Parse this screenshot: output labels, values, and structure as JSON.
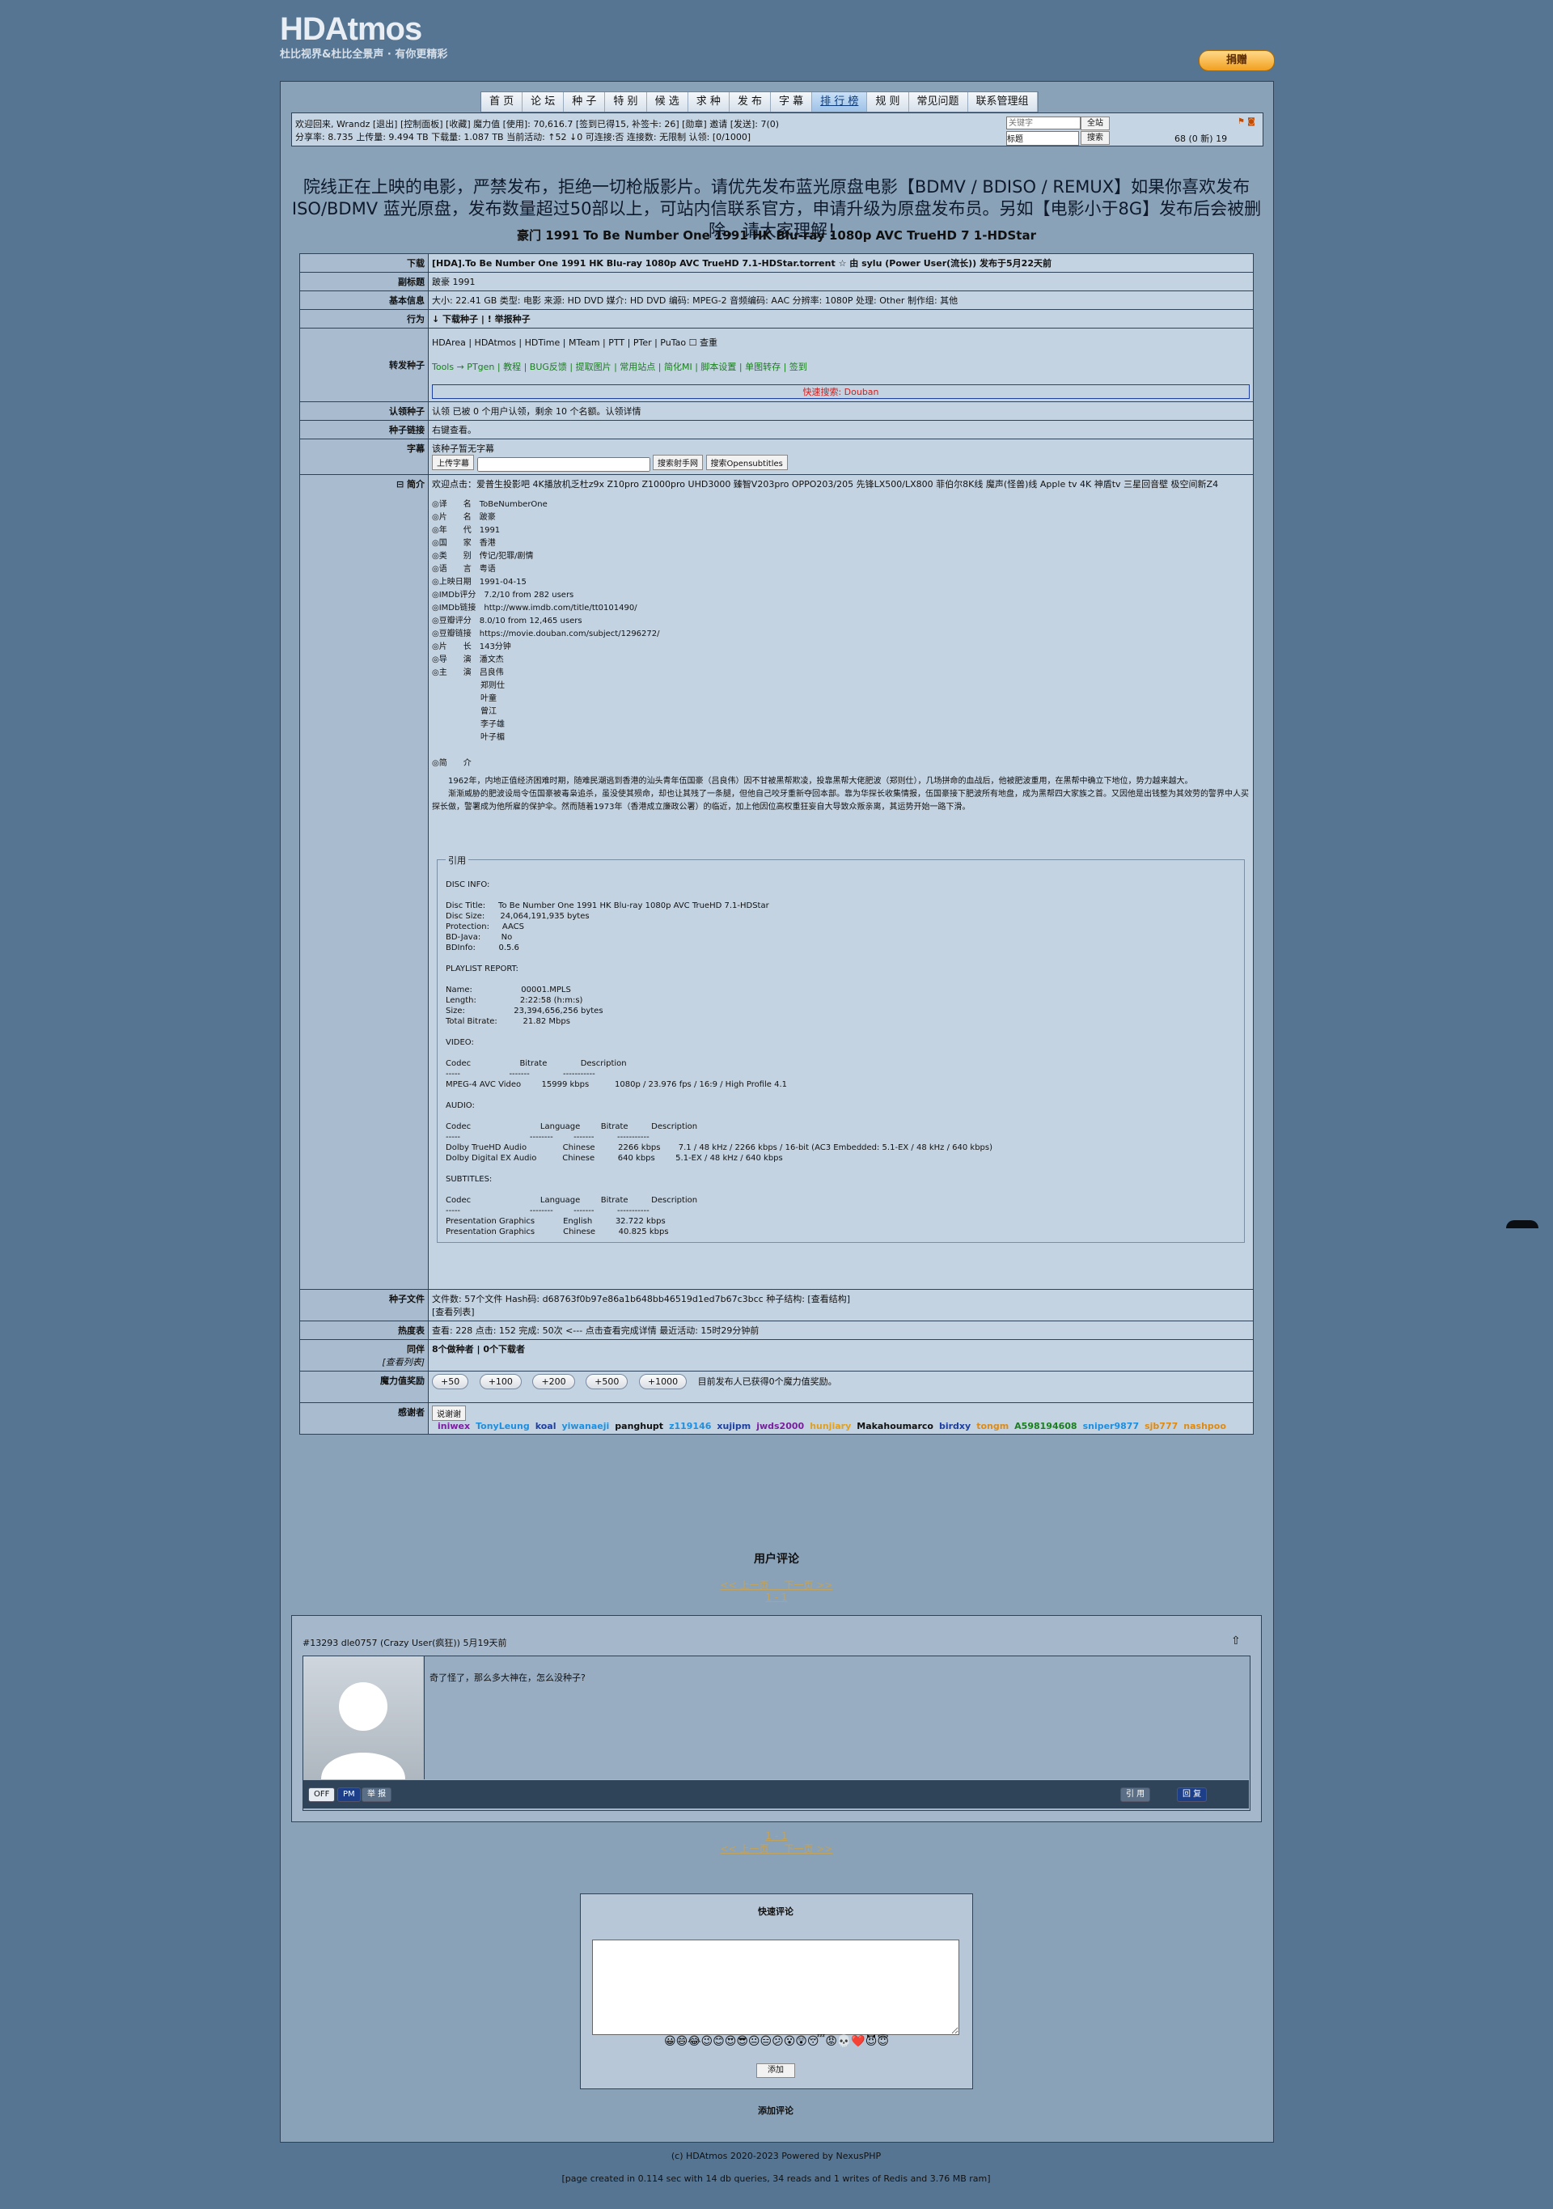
{
  "site": {
    "logo_text": "HDAtmos",
    "tagline": "杜比视界&杜比全景声 · 有你更精彩",
    "donate": "捐赠"
  },
  "nav": [
    "首 页",
    "论 坛",
    "种 子",
    "特 别",
    "候 选",
    "求 种",
    "发 布",
    "字 幕",
    "排 行 榜",
    "规 则",
    "常见问题",
    "联系管理组"
  ],
  "userbar": {
    "line1": "欢迎回来, Wrandz [退出] [控制面板] [收藏] 魔力值 [使用]: 70,616.7 [签到已得15, 补签卡: 26] [勋章] 邀请 [发送]: 7(0)",
    "line2": "分享率: 8.735  上传量: 9.494 TB  下载量: 1.087 TB  当前活动: ↑52 ↓0   可连接:否  连接数: 无限制  认领: [0/1000]",
    "search_placeholder": "关键字",
    "scope_value": "标题",
    "btn_all": "全站",
    "btn_search": "搜索",
    "messages": "68 (0 新)  19"
  },
  "notice": "院线正在上映的电影，严禁发布，拒绝一切枪版影片。请优先发布蓝光原盘电影【BDMV / BDISO / REMUX】如果你喜欢发布ISO/BDMV 蓝光原盘，发布数量超过50部以上，可站内信联系官方，申请升级为原盘发布员。另如【电影小于8G】发布后会被删除，请大家理解！",
  "torrent_title": "豪门 1991 To Be Number One 1991 HK Blu-ray 1080p AVC TrueHD 7 1-HDStar",
  "details": {
    "download_label": "下载",
    "download_value": "[HDA].To Be Number One 1991 HK Blu-ray 1080p AVC TrueHD 7.1-HDStar.torrent  ☆  由 sylu (Power User(流长)) 发布于5月22天前",
    "subtitle_label": "副标题",
    "subtitle_value": "跛豪 1991",
    "basic_label": "基本信息",
    "basic_value": "大小: 22.41 GB  类型: 电影  来源: HD DVD  媒介: HD DVD  编码: MPEG-2  音频编码: AAC  分辨率: 1080P  处理: Other  制作组: 其他",
    "action_label": "行为",
    "action_value": "↓ 下载种子 |  ! 举报种子",
    "forward_label": "转发种子",
    "forward_sites": "HDArea | HDAtmos | HDTime | MTeam |   PTT | PTer | PuTao ☐ 查重",
    "forward_tools": "Tools → PTgen | 教程 | BUG反馈 | 提取图片 | 常用站点 | 简化MI | 脚本设置 | 单图转存 | 签到",
    "quick_search": "快速搜索: Douban",
    "claim_label": "认领种子",
    "claim_value": "认领  已被 0 个用户认领，剩余 10 个名额。认领详情",
    "link_label": "种子链接",
    "link_value": "右键查看。",
    "subs_label": "字幕",
    "subs_none": "该种子暂无字幕",
    "subs_upload": "上传字幕",
    "subs_btn1": "搜索射手网",
    "subs_btn2": "搜索Opensubtitles",
    "intro_label": "⊟ 简介",
    "intro_ad": "欢迎点击：爱普生投影吧 4K播放机乏杜z9x Z10pro Z1000pro UHD3000 臻智V203pro OPPO203/205 先锋LX500/LX800 菲伯尔8K线 魔声(怪兽)线 Apple tv 4K 神盾tv 三星回音壁 极空间新Z4",
    "intro_info": "◎译　　名　ToBeNumberOne\n◎片　　名　跛豪\n◎年　　代　1991\n◎国　　家　香港\n◎类　　别　传记/犯罪/剧情\n◎语　　言　粤语\n◎上映日期　1991-04-15\n◎IMDb评分　7.2/10 from 282 users\n◎IMDb链接　http://www.imdb.com/title/tt0101490/\n◎豆瓣评分　8.0/10 from 12,465 users\n◎豆瓣链接　https://movie.douban.com/subject/1296272/\n◎片　　长　143分钟\n◎导　　演　潘文杰\n◎主　　演　吕良伟\n　　　　　　郑则仕\n　　　　　　叶童\n　　　　　　曾江\n　　　　　　李子雄\n　　　　　　叶子楣\n\n◎简　　介",
    "intro_text": "　　1962年，内地正值经济困难时期，随难民潮逃到香港的汕头青年伍国豪（吕良伟）因不甘被黑帮欺凌，投靠黑帮大佬肥波（郑则仕），几场拼命的血战后，他被肥波重用，在黑帮中确立下地位，势力越来越大。\n　　渐渐威胁的肥波设局令伍国豪被毒枭追杀，虽没使其殒命，却也让其残了一条腿，但他自己咬牙重新夺回本部。靠为华探长收集情报，伍国豪接下肥波所有地盘，成为黑帮四大家族之首。又因他是出钱整为其效劳的警界中人买探长做，警署成为他所雇的保护伞。然而随着1973年（香港成立廉政公署）的临近，加上他因位高权重狂妄自大导致众叛亲离，其运势开始一路下滑。",
    "quote_label": "引用",
    "report": "DISC INFO:\n\nDisc Title:     To Be Number One 1991 HK Blu-ray 1080p AVC TrueHD 7.1-HDStar\nDisc Size:      24,064,191,935 bytes\nProtection:     AACS\nBD-Java:        No\nBDInfo:         0.5.6\n\nPLAYLIST REPORT:\n\nName:                   00001.MPLS\nLength:                 2:22:58 (h:m:s)\nSize:                   23,394,656,256 bytes\nTotal Bitrate:          21.82 Mbps\n\nVIDEO:\n\nCodec                   Bitrate             Description\n-----                   -------             -----------\nMPEG-4 AVC Video        15999 kbps          1080p / 23.976 fps / 16:9 / High Profile 4.1\n\nAUDIO:\n\nCodec                           Language        Bitrate         Description\n-----                           --------        -------         -----------\nDolby TrueHD Audio              Chinese         2266 kbps       7.1 / 48 kHz / 2266 kbps / 16-bit (AC3 Embedded: 5.1-EX / 48 kHz / 640 kbps)\nDolby Digital EX Audio          Chinese         640 kbps        5.1-EX / 48 kHz / 640 kbps\n\nSUBTITLES:\n\nCodec                           Language        Bitrate         Description\n-----                           --------        -------         -----------\nPresentation Graphics           English         32.722 kbps\nPresentation Graphics           Chinese         40.825 kbps",
    "files_label": "种子文件",
    "files_value": "文件数: 57个文件    Hash码: d68763f0b97e86a1b648bb46519d1ed7b67c3bcc    种子结构: [查看结构]",
    "files_list": "[查看列表]",
    "hot_label": "热度表",
    "hot_value": "查看: 228    点击: 152    完成: 50次 <--- 点击查看完成详情    最近活动: 15时29分钟前",
    "peers_label": "同伴",
    "peers_sub": "[查看列表]",
    "peers_value": "8个做种者 | 0个下载者",
    "bonus_label": "魔力值奖励",
    "bonus_buttons": [
      "+50",
      "+100",
      "+200",
      "+500",
      "+1000"
    ],
    "bonus_text": "目前发布人已获得0个魔力值奖励。",
    "thanks_label": "感谢者",
    "thanks_btn": "说谢谢",
    "thanks_users": [
      {
        "name": "iniwex",
        "color": "#7a1f9e"
      },
      {
        "name": "TonyLeung",
        "color": "#1d8fe0"
      },
      {
        "name": "koal",
        "color": "#1d3fa0"
      },
      {
        "name": "yiwanaeji",
        "color": "#1d8fe0"
      },
      {
        "name": "panghupt",
        "color": "#111111"
      },
      {
        "name": "z119146",
        "color": "#1d8fe0"
      },
      {
        "name": "xujipm",
        "color": "#1d3fa0"
      },
      {
        "name": "jwds2000",
        "color": "#7a1f9e"
      },
      {
        "name": "hunjiary",
        "color": "#e0a020"
      },
      {
        "name": "Makahoumarco",
        "color": "#111111"
      },
      {
        "name": "birdxy",
        "color": "#1d3fa0"
      },
      {
        "name": "tongm",
        "color": "#e08a10"
      },
      {
        "name": "A598194608",
        "color": "#18801c"
      },
      {
        "name": "sniper9877",
        "color": "#1d8fe0"
      },
      {
        "name": "sjb777",
        "color": "#e08a10"
      },
      {
        "name": "nashpoo",
        "color": "#e08a10"
      }
    ]
  },
  "comments": {
    "title": "用户评论",
    "prev": "<< 上一页",
    "next": "下一页 >>",
    "page": "1 - 1",
    "meta": "#13293  dle0757 (Crazy User(疯狂))  5月19天前",
    "text": "奇了怪了，那么多大神在，怎么没种子?",
    "off": "OFF",
    "pm": "PM",
    "report": "举 报",
    "quote": "引 用",
    "reply": "回 复"
  },
  "quick": {
    "title": "快速评论",
    "smilies": "😀😄😂😉😊😍😎😐😑😕😮😲😴😡💀❤️😈😇",
    "add": "添加",
    "add_comment": "添加评论"
  },
  "footer": {
    "line1": "(c) HDAtmos 2020-2023 Powered by NexusPHP",
    "line2": "[page created in 0.114 sec with 14 db queries, 34 reads and 1 writes of Redis and 3.76 MB ram]"
  }
}
